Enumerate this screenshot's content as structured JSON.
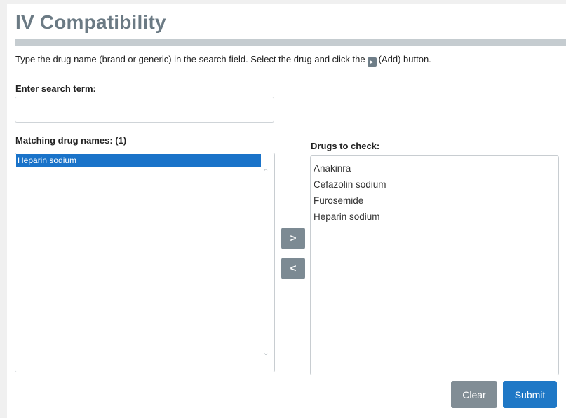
{
  "page": {
    "title": "IV Compatibility",
    "instructions_before": "Type the drug name (brand or generic) in the search field. Select the drug and click the",
    "instructions_after": "(Add) button."
  },
  "search": {
    "label": "Enter search term:",
    "value": "",
    "placeholder": ""
  },
  "matching": {
    "label": "Matching drug names: (1)",
    "items": [
      "Heparin sodium"
    ],
    "selected_index": 0
  },
  "check": {
    "label": "Drugs to check:",
    "items": [
      "Anakinra",
      "Cefazolin sodium",
      "Furosemide",
      "Heparin sodium"
    ]
  },
  "buttons": {
    "add": ">",
    "remove": "<",
    "clear": "Clear",
    "submit": "Submit"
  },
  "colors": {
    "title": "#6b7a84",
    "selection": "#1a73c9",
    "submit": "#1f78c6",
    "secondary_button": "#818d95"
  },
  "icons": {
    "inline_add": "add-arrow-icon",
    "scroll_up": "chevron-up-icon",
    "scroll_down": "chevron-down-icon"
  }
}
